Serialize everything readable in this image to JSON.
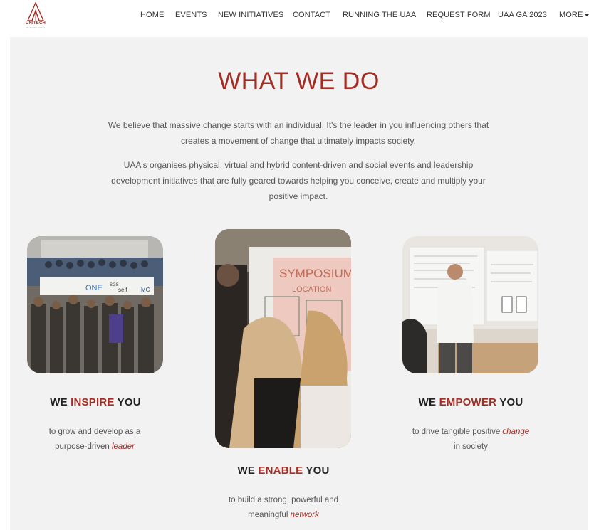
{
  "header": {
    "logo_text": "UNITECH",
    "logo_subtext": "Alumni Association",
    "nav": [
      {
        "label": "HOME"
      },
      {
        "label": "EVENTS"
      },
      {
        "label": "NEW INITIATIVES"
      },
      {
        "label": "CONTACT"
      },
      {
        "label": "RUNNING THE UAA"
      },
      {
        "label": "REQUEST FORM"
      },
      {
        "label": "UAA GA 2023"
      },
      {
        "label": "MORE"
      }
    ]
  },
  "main": {
    "title": "WHAT WE DO",
    "intro": [
      "We believe that massive change starts with an individual. It's the leader in you influencing others that creates a movement of change that ultimately impacts society.",
      "UAA's organises physical, virtual and hybrid content-driven and social events and leadership development initiatives that are fully geared towards helping you conceive, create and multiply your positive impact."
    ],
    "cards": [
      {
        "title_pre": "WE ",
        "title_accent": "INSPIRE",
        "title_post": " YOU",
        "desc_pre": "to grow and develop as a purpose-driven ",
        "desc_em": "leader",
        "desc_post": "",
        "photo_text": [
          "ONE",
          "SGS",
          "seif",
          "MC"
        ]
      },
      {
        "title_pre": "WE ",
        "title_accent": "ENABLE",
        "title_post": " YOU",
        "desc_pre": "to build a strong, powerful and meaningful ",
        "desc_em": "network",
        "desc_post": "",
        "photo_text": [
          "SYMPOSIUM",
          "LOCATION"
        ]
      },
      {
        "title_pre": "WE ",
        "title_accent": "EMPOWER",
        "title_post": " YOU",
        "desc_pre": "to drive tangible positive ",
        "desc_em": "change",
        "desc_post": " in society",
        "photo_text": []
      }
    ]
  },
  "colors": {
    "accent": "#a32d24",
    "content_bg": "#f2f2f2",
    "header_bg": "#ffffff"
  }
}
